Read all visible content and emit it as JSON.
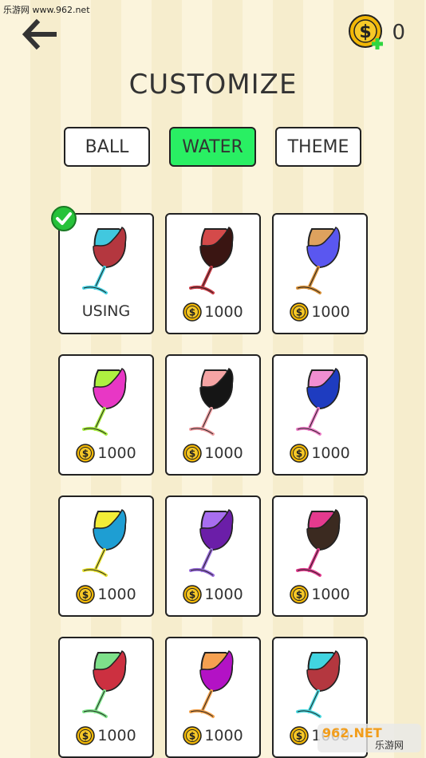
{
  "watermark": "乐游网 www.962.net",
  "header": {
    "title": "CUSTOMIZE",
    "coins": "0"
  },
  "tabs": [
    {
      "label": "BALL",
      "active": false
    },
    {
      "label": "WATER",
      "active": true
    },
    {
      "label": "THEME",
      "active": false
    }
  ],
  "items": [
    {
      "label": "USING",
      "using": true,
      "stem": "#47d3e3",
      "top": "#41c8df",
      "liquid": "#b4373f"
    },
    {
      "label": "1000",
      "using": false,
      "stem": "#c73b45",
      "top": "#d44a4a",
      "liquid": "#3a1512"
    },
    {
      "label": "1000",
      "using": false,
      "stem": "#d9923a",
      "top": "#dea25e",
      "liquid": "#5a57f0"
    },
    {
      "label": "1000",
      "using": false,
      "stem": "#a7ec3f",
      "top": "#aef040",
      "liquid": "#e837c5"
    },
    {
      "label": "1000",
      "using": false,
      "stem": "#f1a0a4",
      "top": "#f5a4a4",
      "liquid": "#151515"
    },
    {
      "label": "1000",
      "using": false,
      "stem": "#ee7fc8",
      "top": "#f08ed1",
      "liquid": "#1e3cc0"
    },
    {
      "label": "1000",
      "using": false,
      "stem": "#e7e234",
      "top": "#f2ec37",
      "liquid": "#1e9ed3"
    },
    {
      "label": "1000",
      "using": false,
      "stem": "#9a6cdc",
      "top": "#a86ef0",
      "liquid": "#6b1ea8"
    },
    {
      "label": "1000",
      "using": false,
      "stem": "#e23c8f",
      "top": "#e43a8e",
      "liquid": "#3b2a20"
    },
    {
      "label": "1000",
      "using": false,
      "stem": "#7fe48a",
      "top": "#7ee08a",
      "liquid": "#cc3040"
    },
    {
      "label": "1000",
      "using": false,
      "stem": "#f2a04a",
      "top": "#f5a050",
      "liquid": "#b312c5"
    },
    {
      "label": "1000",
      "using": false,
      "stem": "#4bd9e0",
      "top": "#41d4e0",
      "liquid": "#b4373f"
    }
  ],
  "bottom_watermark": "962.NET 乐游网"
}
